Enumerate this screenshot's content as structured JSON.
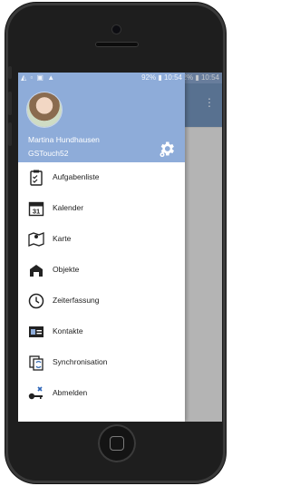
{
  "status_bar": {
    "left_icons": "◭ ▫ ▣ ▲",
    "right": "92% ▮ 10:54"
  },
  "drawer": {
    "user_name": "Martina Hundhausen",
    "account": "GSTouch52",
    "items": [
      {
        "label": "Aufgabenliste",
        "icon": "clipboard-icon"
      },
      {
        "label": "Kalender",
        "icon": "calendar-icon"
      },
      {
        "label": "Karte",
        "icon": "map-icon"
      },
      {
        "label": "Objekte",
        "icon": "objects-icon"
      },
      {
        "label": "Zeiterfassung",
        "icon": "clock-icon"
      },
      {
        "label": "Kontakte",
        "icon": "contact-card-icon"
      },
      {
        "label": "Synchronisation",
        "icon": "sync-icon"
      },
      {
        "label": "Abmelden",
        "icon": "logout-key-icon"
      }
    ]
  },
  "calendar_icon_day": "31",
  "colors": {
    "drawer_header": "#8eacd9",
    "app_bar": "#6c8ab0",
    "phone_body": "#1e1e1e"
  }
}
